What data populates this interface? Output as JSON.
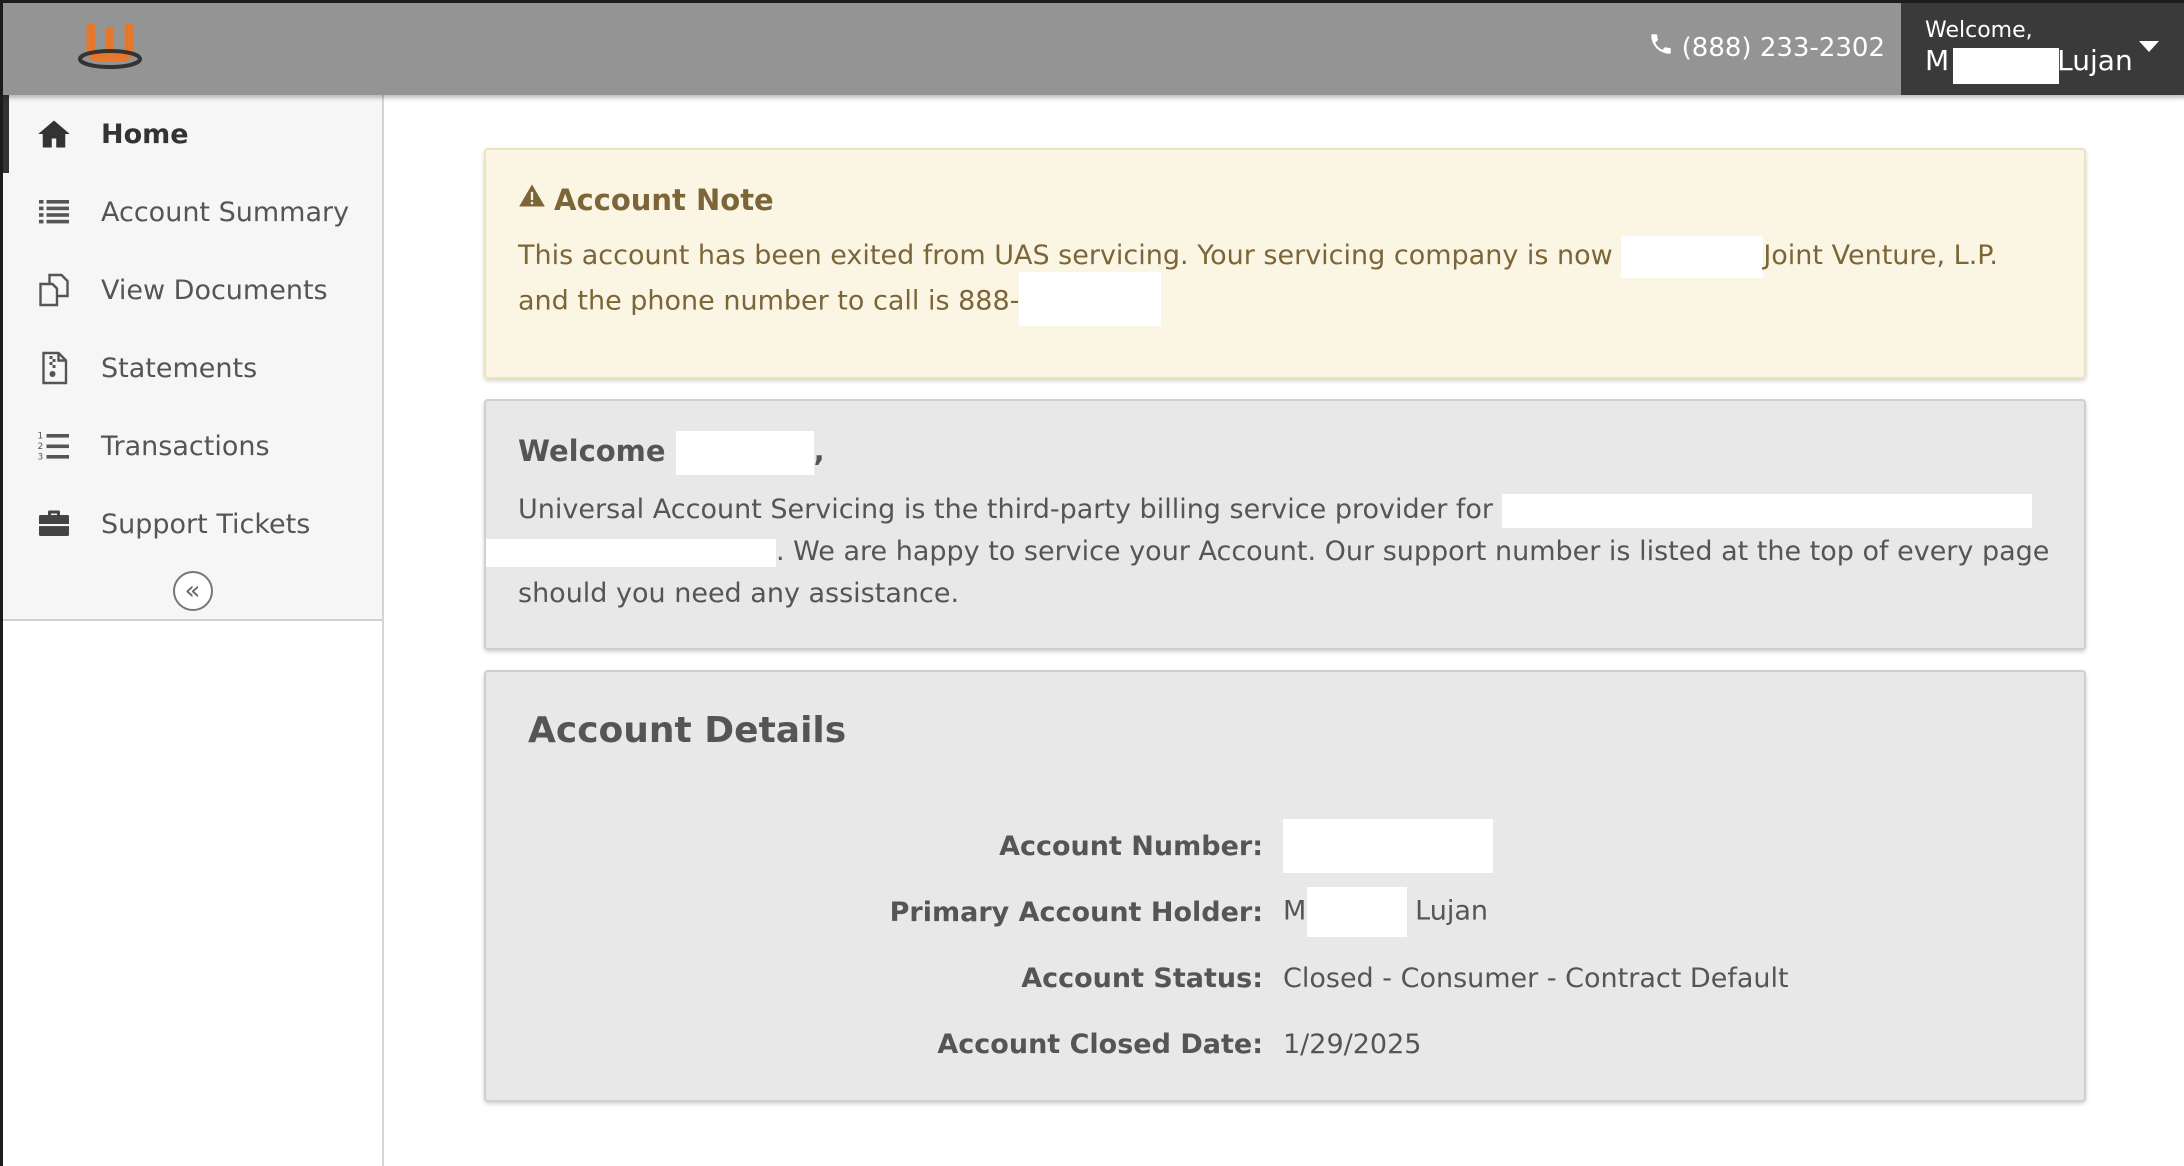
{
  "header": {
    "phone": "(888) 233-2302",
    "welcome_label": "Welcome,",
    "user_name_start": "M",
    "user_name_end": "Lujan"
  },
  "sidebar": {
    "items": [
      {
        "label": "Home",
        "icon": "home-icon"
      },
      {
        "label": "Account Summary",
        "icon": "list-icon"
      },
      {
        "label": "View Documents",
        "icon": "documents-icon"
      },
      {
        "label": "Statements",
        "icon": "zip-file-icon"
      },
      {
        "label": "Transactions",
        "icon": "ordered-list-icon"
      },
      {
        "label": "Support Tickets",
        "icon": "briefcase-icon"
      }
    ],
    "collapse_glyph": "«"
  },
  "note": {
    "title": "Account Note",
    "text_1": "This account has been exited from UAS servicing. Your servicing company is now ",
    "text_2": "Joint Venture, L.P. and the phone number to call is 888-"
  },
  "welcome": {
    "title_start": "Welcome ",
    "title_end": ",",
    "body_1": "Universal Account Servicing is the third-party billing service provider for ",
    "body_2": ". We are happy to service your Account. Our support number is listed at the top of every page should you need any assistance."
  },
  "details": {
    "title": "Account Details",
    "rows": [
      {
        "label": "Account Number:",
        "value": ""
      },
      {
        "label": "Primary Account Holder:",
        "value_start": "Mc",
        "value_end": "Lujan"
      },
      {
        "label": "Account Status:",
        "value": "Closed - Consumer - Contract Default"
      },
      {
        "label": "Account Closed Date:",
        "value": "1/29/2025"
      }
    ]
  },
  "colors": {
    "header_bg": "#949494",
    "user_menu_bg": "#3a3a3a",
    "note_bg": "#fbf6e3",
    "note_text": "#7c6538",
    "panel_bg": "#e8e8e8",
    "brand_orange": "#e8772e"
  }
}
